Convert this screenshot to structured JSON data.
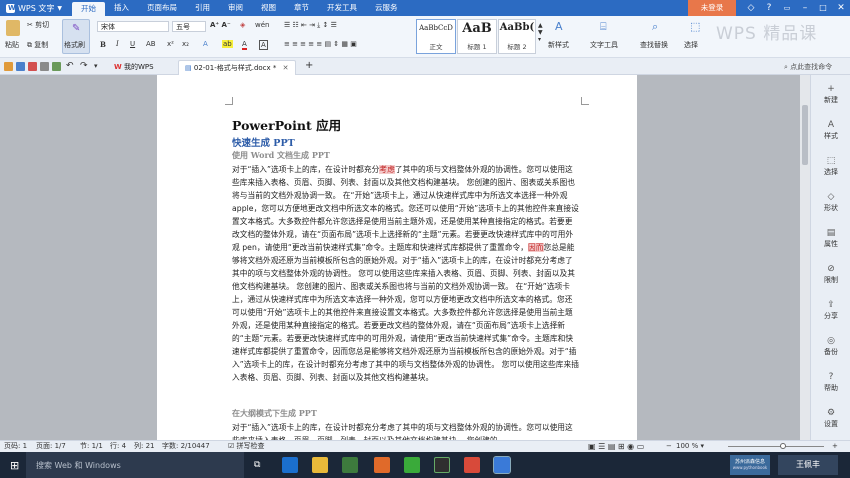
{
  "titlebar": {
    "app_name": "WPS 文字",
    "tabs": [
      "开始",
      "插入",
      "页面布局",
      "引用",
      "审阅",
      "视图",
      "章节",
      "开发工具",
      "云服务"
    ],
    "login": "未登录",
    "brand": "WPS 精品课"
  },
  "ribbon": {
    "cut": "剪切",
    "copy": "复制",
    "paste": "粘贴",
    "format_painter": "格式刷",
    "font_name": "宋体",
    "font_size": "五号",
    "styles": [
      {
        "preview": "AaBbCcD",
        "label": "正文"
      },
      {
        "preview": "AaB",
        "label": "标题 1"
      },
      {
        "preview": "AaBb(",
        "label": "标题 2"
      }
    ],
    "new_style": "新样式",
    "text_tools": "文字工具",
    "find_replace": "查找替换",
    "select": "选择"
  },
  "qat": {
    "tabs": [
      {
        "label": "我的WPS"
      },
      {
        "label": "02-01-格式与样式.docx *"
      }
    ],
    "search_placeholder": "点此查找命令"
  },
  "document": {
    "title": "PowerPoint 应用",
    "h1": "快速生成 PPT",
    "h2": "使用 Word 文档生成 PPT",
    "h3": "在大纲模式下生成 PPT",
    "p1_before": "对于“插入”选项卡上的库，在设计时都充分",
    "p1_highlight": "考虑",
    "p1_mid": "了其中的项与文档整体外观的协调性。您可以使用这些库来插入表格、页眉、页脚、列表、封面以及其他文档构建基块。 您创建的图片、图表或关系图也将与当前的文档外观协调一致。 在“开始”选项卡上，通过从快速样式库中为所选文本选择一种外观 apple，您可以方便地更改文档中所选文本的格式。您还可以使用“开始”选项卡上的其他控件来直接设置文本格式。大多数控件都允许您选择是使用当前主题外观，还是使用某种直接指定的格式。若要更改文档的整体外观，请在“页面布局”选项卡上选择新的“主题”元素。若要更改快速样式库中的可用外观 pen，请使用“更改当前快速样式集”命令。主题库和快速样式库都提供了重置命令，",
    "p1_highlight2": "因而",
    "p1_after": "您总是能够将文档外观还原为当前模板所包含的原始外观。对于“插入”选项卡上的库，在设计时都充分考虑了其中的项与文档整体外观的协调性。 您可以使用这些库来插入表格、页眉、页脚、列表、封面以及其他文档构建基块。 您创建的图片、图表或关系图也将与当前的文档外观协调一致。 在“开始”选项卡上，通过从快速样式库中为所选文本选择一种外观，您可以方便地更改文档中所选文本的格式。您还可以使用“开始”选项卡上的其他控件来直接设置文本格式。大多数控件都允许您选择是使用当前主题外观，还是使用某种直接指定的格式。若要更改文档的整体外观，请在“页面布局”选项卡上选择新的“主题”元素。若要更改快速样式库中的可用外观，请使用“更改当前快速样式集”命令。主题库和快速样式库都提供了重置命令，因而您总是能够将文档外观还原为当前模板所包含的原始外观。对于“插入”选项卡上的库，在设计时都充分考虑了其中的项与文档整体外观的协调性。 您可以使用这些库来插入表格、页眉、页脚、列表、封面以及其他文档构建基块。",
    "p2": "对于“插入”选项卡上的库，在设计时都充分考虑了其中的项与文档整体外观的协调性。您可以使用这些库来插入表格、页眉、页脚、列表、封面以及其他文档构建基块。 您创建的"
  },
  "right_panel": [
    "新建",
    "样式",
    "选择",
    "形状",
    "属性",
    "限制",
    "分享",
    "备份",
    "帮助",
    "设置"
  ],
  "status": {
    "page": "页码: 1",
    "pages": "页面: 1/7",
    "section": "节: 1/1",
    "line": "行: 4",
    "col": "列: 21",
    "words": "字数: 2/10447",
    "spell": "拼写检查",
    "zoom": "100 %"
  },
  "taskbar": {
    "search_placeholder": "搜索 Web 和 Windows",
    "user": "王佩丰",
    "tray_text": "苏州派森信息",
    "tray_sub": "www.pythonbook"
  },
  "colors": {
    "title_blue": "#2c6bc2",
    "heading_blue": "#2d5ca8",
    "login_orange": "#e8774a",
    "highlight_red": "#c02323"
  }
}
